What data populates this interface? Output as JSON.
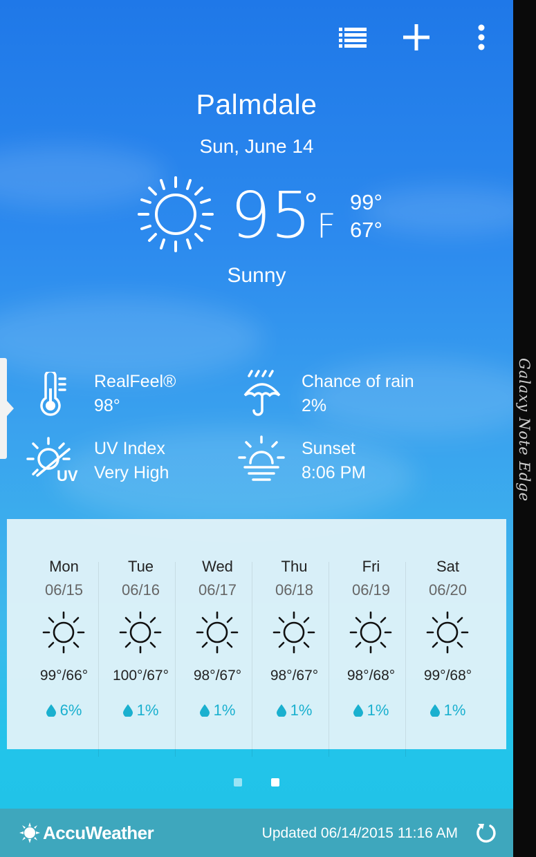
{
  "toolbar": {
    "list_icon": "list-icon",
    "add_icon": "plus-icon",
    "menu_icon": "more-vert-icon"
  },
  "current": {
    "city": "Palmdale",
    "date": "Sun, June 14",
    "temperature": "95",
    "degree_symbol": "°",
    "unit": "F",
    "high": "99°",
    "low": "67°",
    "condition": "Sunny",
    "condition_icon": "sun-icon"
  },
  "details": [
    {
      "icon": "thermometer-icon",
      "label": "RealFeel®",
      "value": "98°"
    },
    {
      "icon": "umbrella-rain-icon",
      "label": "Chance of rain",
      "value": "2%"
    },
    {
      "icon": "uv-index-icon",
      "label": "UV Index",
      "value": "Very High"
    },
    {
      "icon": "sunset-icon",
      "label": "Sunset",
      "value": "8:06 PM"
    }
  ],
  "forecast": [
    {
      "day": "Mon",
      "date": "06/15",
      "temps": "99°/66°",
      "rain": "6%"
    },
    {
      "day": "Tue",
      "date": "06/16",
      "temps": "100°/67°",
      "rain": "1%"
    },
    {
      "day": "Wed",
      "date": "06/17",
      "temps": "98°/67°",
      "rain": "1%"
    },
    {
      "day": "Thu",
      "date": "06/18",
      "temps": "98°/67°",
      "rain": "1%"
    },
    {
      "day": "Fri",
      "date": "06/19",
      "temps": "98°/68°",
      "rain": "1%"
    },
    {
      "day": "Sat",
      "date": "06/20",
      "temps": "99°/68°",
      "rain": "1%"
    }
  ],
  "pager": {
    "pages": 2,
    "active": 2
  },
  "footer": {
    "brand": "AccuWeather",
    "updated": "Updated 06/14/2015 11:16 AM",
    "refresh_icon": "refresh-icon"
  },
  "edge_panel": {
    "label": "Galaxy Note Edge"
  },
  "colors": {
    "accent_rain": "#1ab0cf",
    "footer_bg": "#3ea7bd",
    "sky_top": "#1f78e8",
    "sky_bottom": "#20c2e6"
  }
}
